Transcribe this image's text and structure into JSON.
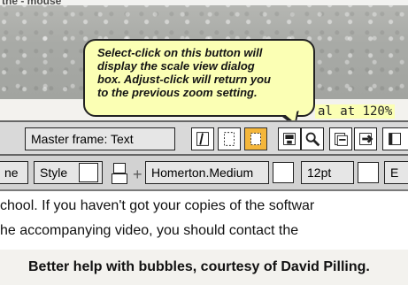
{
  "canvas": {
    "top_fragment": "the - mouse"
  },
  "bubble": {
    "text": "Select-click on this button will\ndisplay the scale view dialog\nbox.  Adjust-click will return you\nto the previous zoom setting."
  },
  "status": {
    "zoom_text": "al at 120%"
  },
  "toolbar1": {
    "frame_label": "Master frame: Text",
    "icons": [
      "frame-select-icon",
      "frame-box-icon",
      "frame-highlight-icon",
      "save-icon",
      "zoom-magnifier-icon",
      "copy-icon",
      "import-icon"
    ]
  },
  "toolbar2": {
    "left_fragment": "ne",
    "style_label": "Style",
    "font_value": "Homerton.Medium",
    "size_value": "12pt",
    "right_fragment": "E"
  },
  "document": {
    "line1": "chool. If you haven't got your copies of the softwar",
    "line2": "he accompanying video, you should contact the"
  },
  "caption": {
    "text": "Better help with bubbles, courtesy of David Pilling."
  }
}
